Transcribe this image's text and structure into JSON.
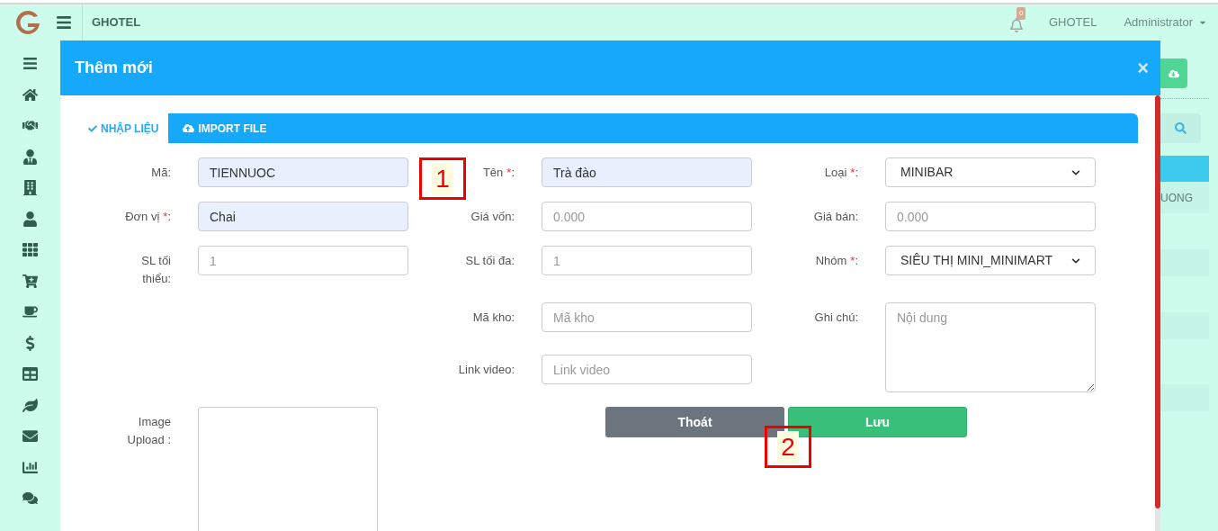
{
  "topbar": {
    "brand": "GHOTEL",
    "notification_count": "0",
    "hotel": "GHOTEL",
    "user": "Administrator"
  },
  "modal": {
    "title": "Thêm mới",
    "close": "×",
    "tabs": [
      {
        "label": "NHẬP LIỆU",
        "selected": true
      },
      {
        "label": "IMPORT FILE",
        "selected": false
      }
    ],
    "columns": [
      [
        {
          "kind": "input",
          "label": "Mã:",
          "value": "TIENNUOC",
          "filled": true
        },
        {
          "kind": "input",
          "label": "Đơn vị",
          "required_mark": "*",
          "suffix": ":",
          "value": "Chai",
          "filled": true
        },
        {
          "kind": "input",
          "label": "SL tối thiểu:",
          "placeholder": "1",
          "filled": false
        }
      ],
      [
        {
          "kind": "input",
          "label": "Tên",
          "required_mark": "*",
          "suffix": ":",
          "value": "Trà đào",
          "filled": true
        },
        {
          "kind": "input",
          "label": "Giá vốn:",
          "placeholder": "0.000",
          "filled": false
        },
        {
          "kind": "input",
          "label": "SL tối đa:",
          "placeholder": "1",
          "filled": false
        },
        {
          "kind": "input",
          "label": "Mã kho:",
          "placeholder": "Mã kho",
          "filled": false
        },
        {
          "kind": "input",
          "label": "Link video:",
          "placeholder": "Link video",
          "filled": false
        }
      ],
      [
        {
          "kind": "select",
          "label": "Loại",
          "required_mark": "*",
          "suffix": ":",
          "value": "MINIBAR"
        },
        {
          "kind": "input",
          "label": "Giá bán:",
          "placeholder": "0.000",
          "filled": false
        },
        {
          "kind": "select",
          "label": "Nhóm",
          "required_mark": "*",
          "suffix": ":",
          "value": "SIÊU THỊ MINI_MINIMART"
        },
        {
          "kind": "textarea",
          "label": "Ghi chú:",
          "placeholder": "Nội dung"
        }
      ]
    ],
    "image_upload": {
      "label": "Image Upload :"
    },
    "buttons": [
      {
        "label": "Thoát",
        "kind": "secondary"
      },
      {
        "label": "Lưu",
        "kind": "primary"
      }
    ]
  },
  "annotations": [
    {
      "label": "1"
    },
    {
      "label": "2"
    }
  ],
  "background": {
    "table_text": "UONG"
  }
}
